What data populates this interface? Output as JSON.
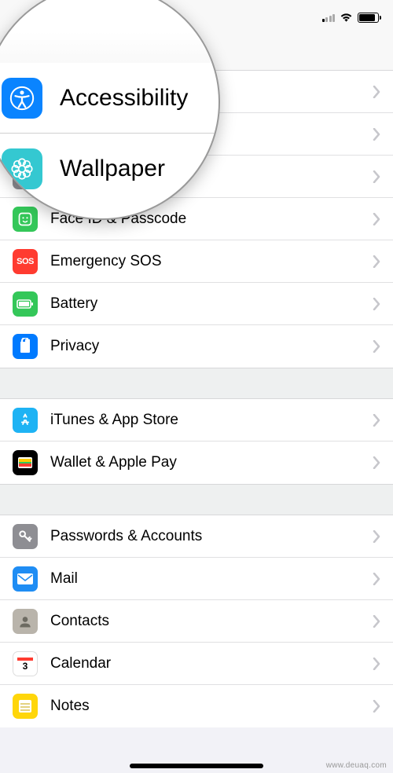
{
  "magnifier": {
    "rows": [
      {
        "label": "Accessibility",
        "icon": "accessibility-icon",
        "icon_bg": "#0a84ff"
      },
      {
        "label": "Wallpaper",
        "icon": "wallpaper-icon",
        "icon_bg": "#34c8d1"
      }
    ]
  },
  "settings": {
    "group1": [
      {
        "label": "Face ID & Passcode",
        "icon": "faceid-icon",
        "icon_bg": "#34c759"
      },
      {
        "label": "Emergency SOS",
        "icon": "sos-icon",
        "icon_bg": "#ff3b30"
      },
      {
        "label": "Battery",
        "icon": "battery-icon",
        "icon_bg": "#34c759"
      },
      {
        "label": "Privacy",
        "icon": "privacy-icon",
        "icon_bg": "#007aff"
      }
    ],
    "group2": [
      {
        "label": "iTunes & App Store",
        "icon": "appstore-icon",
        "icon_bg": "#1eb3f4"
      },
      {
        "label": "Wallet & Apple Pay",
        "icon": "wallet-icon",
        "icon_bg": "#000000"
      }
    ],
    "group3": [
      {
        "label": "Passwords & Accounts",
        "icon": "key-icon",
        "icon_bg": "#8e8e93"
      },
      {
        "label": "Mail",
        "icon": "mail-icon",
        "icon_bg": "#1f8df4"
      },
      {
        "label": "Contacts",
        "icon": "contacts-icon",
        "icon_bg": "#b9b4ab"
      },
      {
        "label": "Calendar",
        "icon": "calendar-icon",
        "icon_bg": "#ffffff"
      },
      {
        "label": "Notes",
        "icon": "notes-icon",
        "icon_bg": "#ffd60a"
      }
    ]
  },
  "watermark": "www.deuaq.com"
}
